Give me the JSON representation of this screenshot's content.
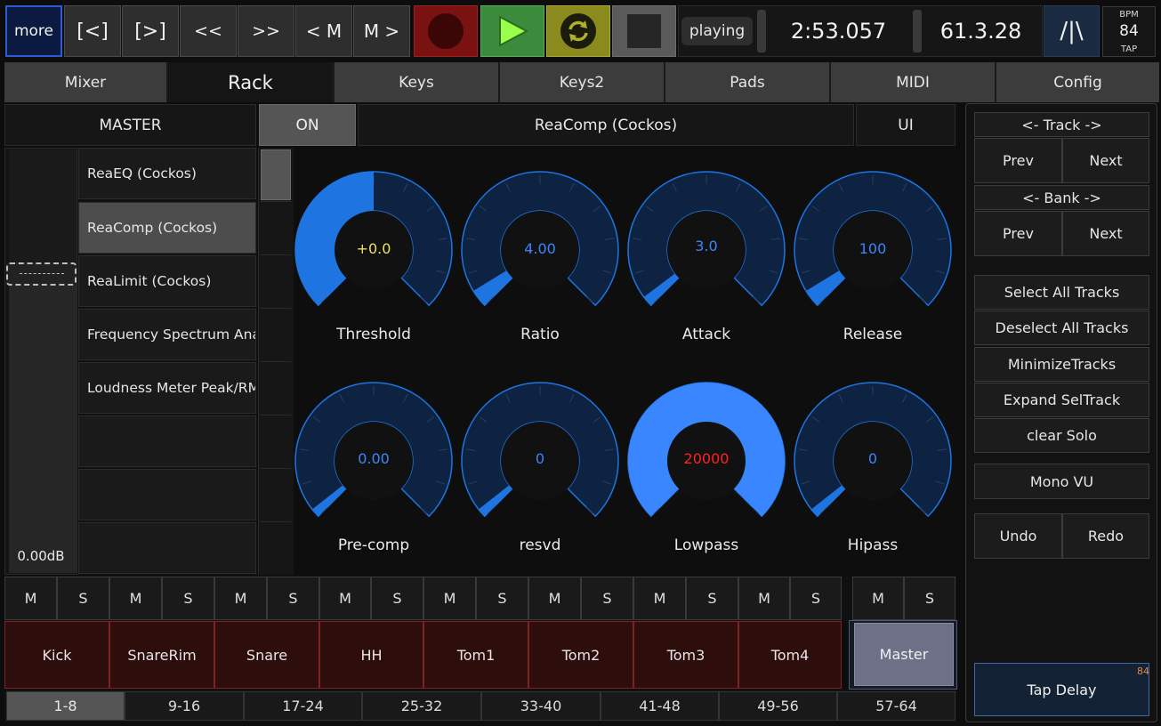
{
  "transport": {
    "more": "more",
    "prev_marker_short": "[<]",
    "next_marker_short": "[>]",
    "rewind": "<<",
    "forward": ">>",
    "prev_m": "< M",
    "next_m": "M >",
    "status": "playing",
    "time": "2:53.057",
    "beats": "61.3.28",
    "metronome": "/|\\",
    "bpm_label": "BPM",
    "bpm_value": "84",
    "tap_label": "TAP"
  },
  "tabs": [
    "Mixer",
    "Rack",
    "Keys",
    "Keys2",
    "Pads",
    "MIDI",
    "Config"
  ],
  "rack": {
    "track_name": "MASTER",
    "on_label": "ON",
    "fx_name": "ReaComp (Cockos)",
    "ui_label": "UI",
    "fader_value": "0.00dB",
    "fx_list": [
      "ReaEQ (Cockos)",
      "ReaComp (Cockos)",
      "ReaLimit (Cockos)",
      "Frequency Spectrum Ana",
      "Loudness Meter Peak/RM",
      "",
      "",
      ""
    ],
    "knobs": [
      {
        "label": "Threshold",
        "value": "+0.0",
        "level": 0.5,
        "value_color": "#f0e060"
      },
      {
        "label": "Ratio",
        "value": "4.00",
        "level": 0.05,
        "value_color": "#3a86ff"
      },
      {
        "label": "Attack",
        "value": "3.0",
        "level": 0.03,
        "value_color": "#3a86ff"
      },
      {
        "label": "Release",
        "value": "100",
        "level": 0.05,
        "value_color": "#3a86ff"
      },
      {
        "label": "Pre-comp",
        "value": "0.00",
        "level": 0.0,
        "value_color": "#3a86ff"
      },
      {
        "label": "resvd",
        "value": "0",
        "level": 0.0,
        "value_color": "#3a86ff"
      },
      {
        "label": "Lowpass",
        "value": "20000",
        "level": 1.0,
        "value_color": "#ff2222"
      },
      {
        "label": "Hipass",
        "value": "0",
        "level": 0.0,
        "value_color": "#3a86ff"
      }
    ]
  },
  "right_panel": {
    "track_nav": "<-  Track  ->",
    "bank_nav": "<-  Bank  ->",
    "prev": "Prev",
    "next": "Next",
    "select_all": "Select All Tracks",
    "deselect_all": "Deselect All Tracks",
    "minimize": "MinimizeTracks",
    "expand": "Expand SelTrack",
    "clear_solo": "clear Solo",
    "mono_vu": "Mono VU",
    "undo": "Undo",
    "redo": "Redo",
    "tap_delay": "Tap Delay",
    "tap_delay_value": "84"
  },
  "mute_label": "M",
  "solo_label": "S",
  "tracks": [
    "Kick",
    "SnareRim",
    "Snare",
    "HH",
    "Tom1",
    "Tom2",
    "Tom3",
    "Tom4"
  ],
  "master_track": "Master",
  "banks": [
    "1-8",
    "9-16",
    "17-24",
    "25-32",
    "33-40",
    "41-48",
    "49-56",
    "57-64"
  ],
  "colors": {
    "knob_blue": "#1e74e0",
    "knob_dark": "#0e2342",
    "record": "#4a0808",
    "play": "#3c8a3c",
    "loop": "#8a8a1e"
  }
}
